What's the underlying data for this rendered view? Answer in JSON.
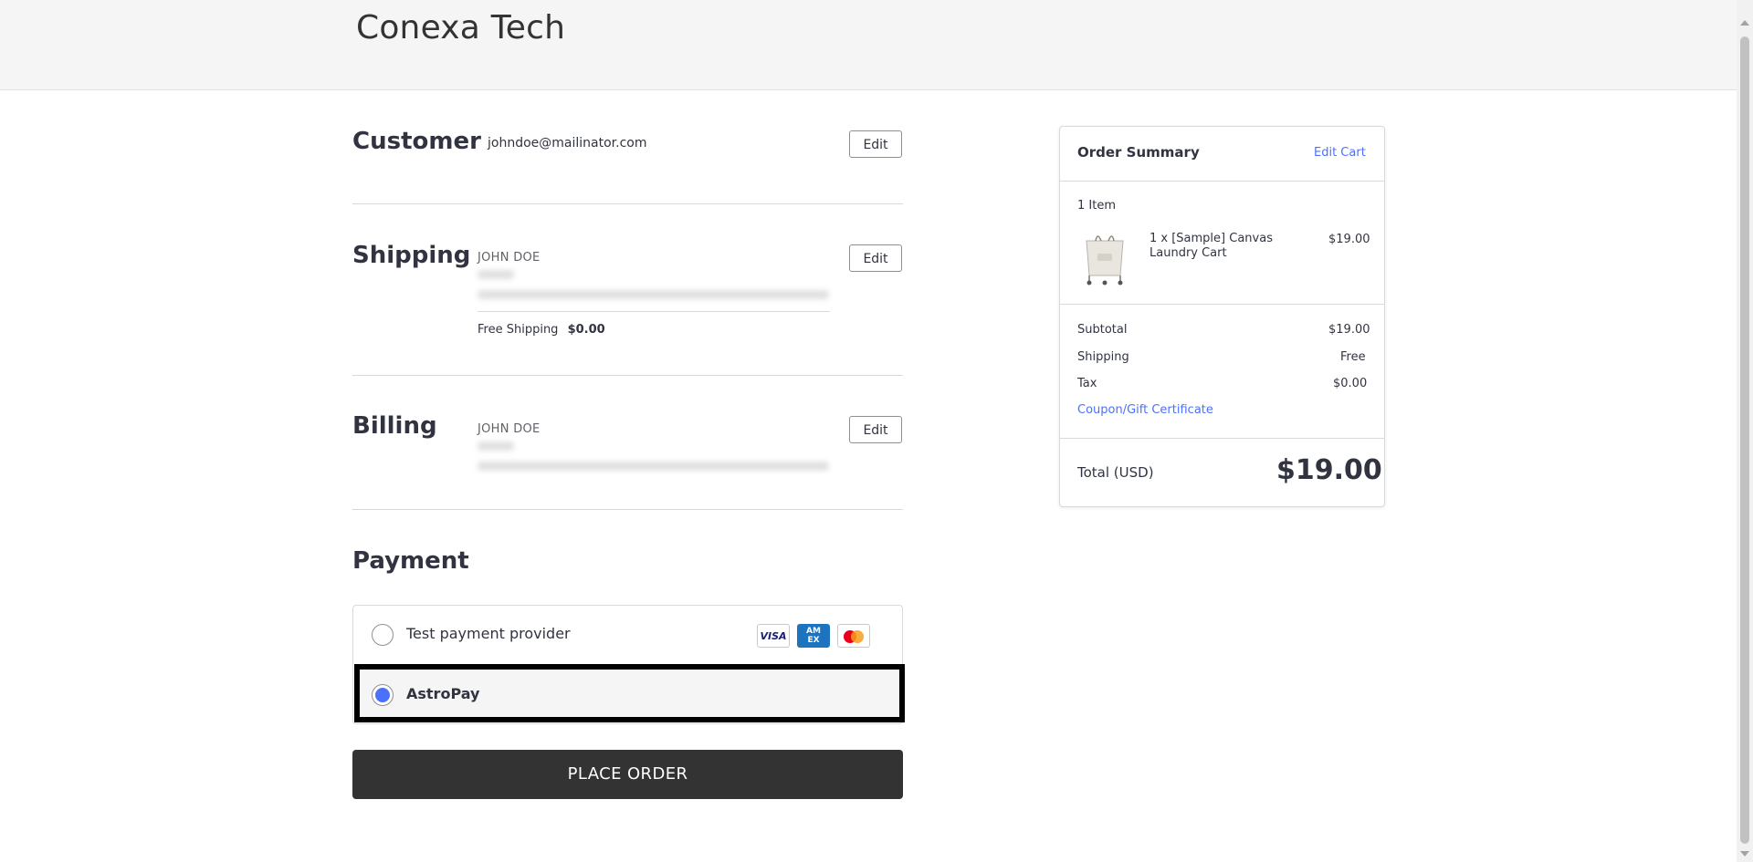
{
  "header": {
    "brand": "Conexa Tech"
  },
  "customer": {
    "title": "Customer",
    "email": "johndoe@mailinator.com",
    "edit_label": "Edit"
  },
  "shipping": {
    "title": "Shipping",
    "name": "JOHN DOE",
    "method": "Free Shipping",
    "cost": "$0.00",
    "edit_label": "Edit"
  },
  "billing": {
    "title": "Billing",
    "name": "JOHN DOE",
    "edit_label": "Edit"
  },
  "payment": {
    "title": "Payment",
    "options": [
      {
        "label": "Test payment provider",
        "selected": false
      },
      {
        "label": "AstroPay",
        "selected": true
      }
    ],
    "cards": [
      "VISA",
      "AMEX",
      "mastercard"
    ],
    "place_order_label": "PLACE ORDER"
  },
  "order_summary": {
    "title": "Order Summary",
    "edit_cart_label": "Edit Cart",
    "item_count": "1 Item",
    "items": [
      {
        "name": "1 x [Sample] Canvas Laundry Cart",
        "price": "$19.00"
      }
    ],
    "subtotal_label": "Subtotal",
    "subtotal": "$19.00",
    "shipping_label": "Shipping",
    "shipping": "Free",
    "tax_label": "Tax",
    "tax": "$0.00",
    "coupon_label": "Coupon/Gift Certificate",
    "total_label": "Total (USD)",
    "total": "$19.00"
  },
  "colors": {
    "accent": "#4b71fc",
    "button_dark": "#333333"
  }
}
